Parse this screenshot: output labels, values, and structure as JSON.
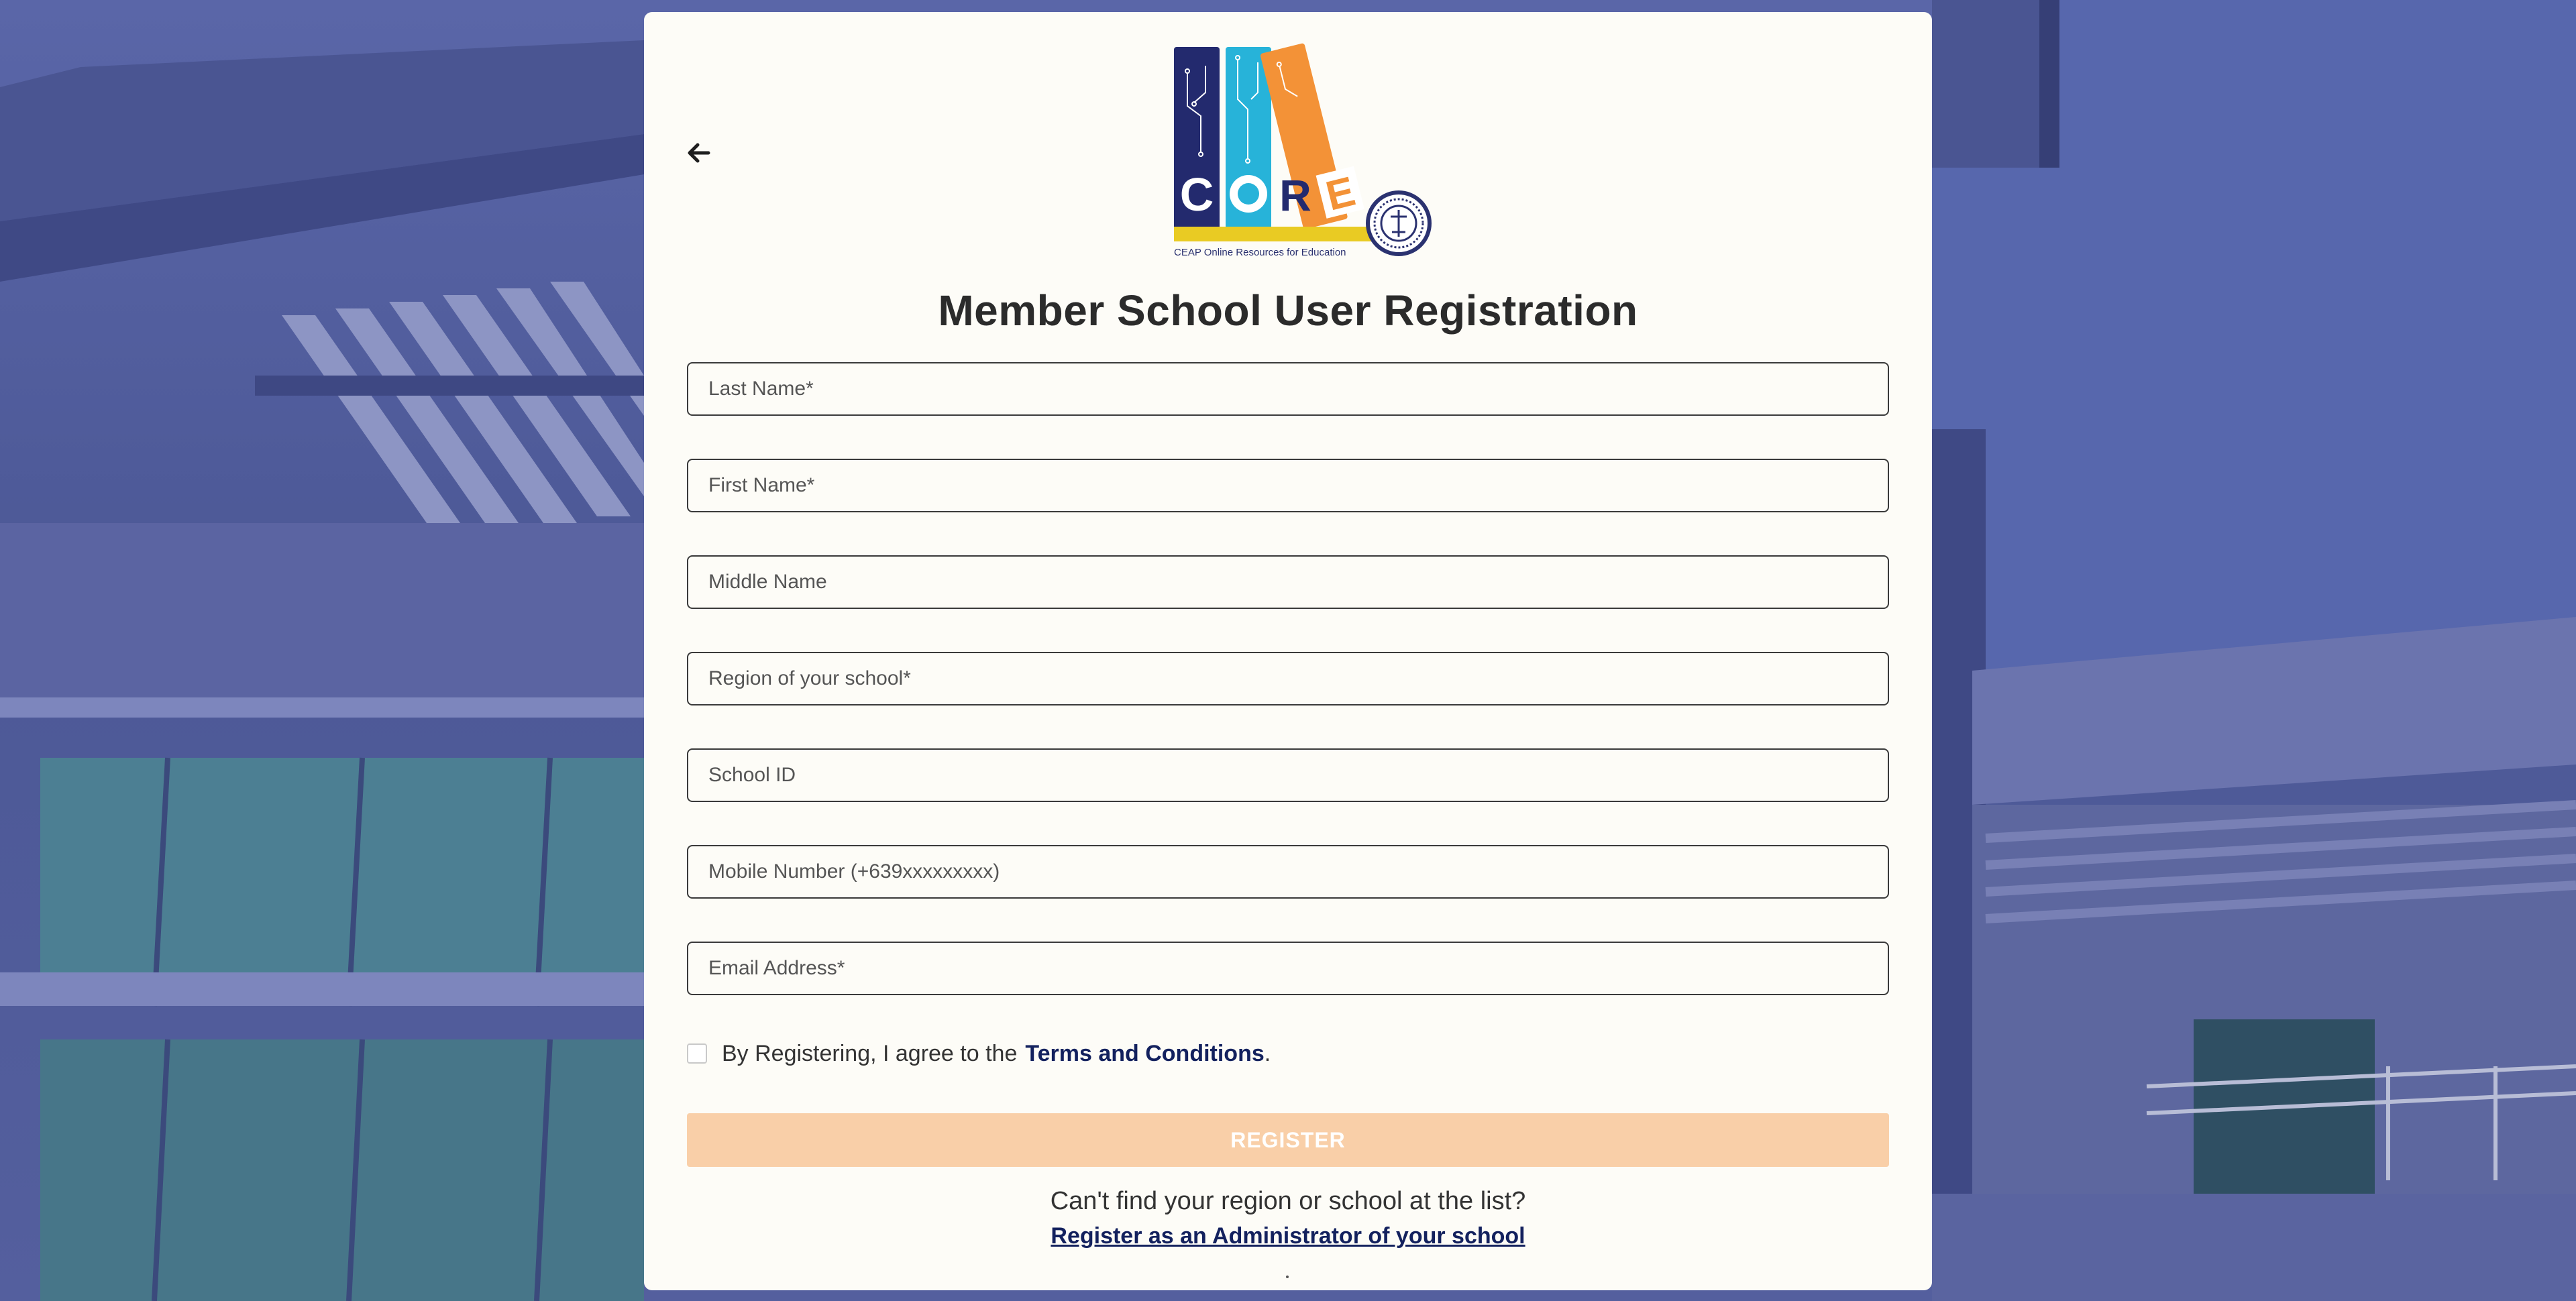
{
  "page": {
    "title": "Member School User Registration",
    "logo": {
      "letters": [
        "C",
        "O",
        "R",
        "E"
      ],
      "tagline": "CEAP Online Resources for Education",
      "colors": {
        "navy": "#232a6e",
        "cyan": "#27b3d9",
        "orange": "#f39237",
        "yellow": "#e9cb23",
        "seal": "#2b3270"
      }
    }
  },
  "form": {
    "last_name_placeholder": "Last Name*",
    "first_name_placeholder": "First Name*",
    "middle_name_placeholder": "Middle Name",
    "region_placeholder": "Region of your school*",
    "school_id_placeholder": "School ID",
    "mobile_placeholder": "Mobile Number (+639xxxxxxxxx)",
    "email_placeholder": "Email Address*",
    "agree_text": "By Registering, I agree to the",
    "terms_link": "Terms and Conditions",
    "terms_suffix": ".",
    "register_label": "REGISTER"
  },
  "footer": {
    "cant_find": "Can't find your region or school at the list?",
    "admin_link": "Register as an Administrator of your school"
  },
  "icons": {
    "back": "arrow-left-icon"
  },
  "colors": {
    "accent_disabled": "#f9cfa8",
    "link": "#13215e",
    "card_bg": "#fdfcf7"
  }
}
